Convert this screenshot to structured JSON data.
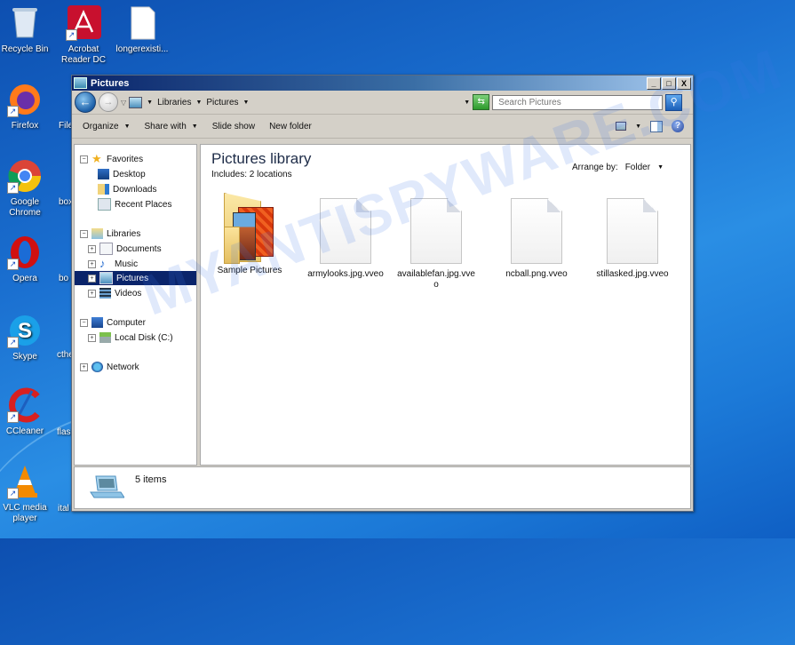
{
  "desktop": {
    "icons": [
      {
        "name": "recycle-bin",
        "label": "Recycle Bin"
      },
      {
        "name": "acrobat-reader",
        "label": "Acrobat Reader DC"
      },
      {
        "name": "longerexisting-file",
        "label": "longerexisti..."
      },
      {
        "name": "firefox",
        "label": "Firefox"
      },
      {
        "name": "google-chrome",
        "label": "Google Chrome"
      },
      {
        "name": "opera",
        "label": "Opera"
      },
      {
        "name": "skype",
        "label": "Skype"
      },
      {
        "name": "ccleaner",
        "label": "CCleaner"
      },
      {
        "name": "vlc",
        "label": "VLC media player"
      }
    ],
    "partial_labels": [
      "File",
      "box",
      "bo",
      "cthe",
      "flas",
      "ital"
    ]
  },
  "window": {
    "title": "Pictures",
    "controls": {
      "minimize": "_",
      "maximize": "□",
      "close": "X"
    },
    "address": {
      "segments": [
        "Libraries",
        "Pictures"
      ]
    },
    "search": {
      "placeholder": "Search Pictures"
    },
    "toolbar": {
      "organize": "Organize",
      "share_with": "Share with",
      "slide_show": "Slide show",
      "new_folder": "New folder",
      "help": "?"
    },
    "nav_tree": {
      "favorites": "Favorites",
      "desktop": "Desktop",
      "downloads": "Downloads",
      "recent_places": "Recent Places",
      "libraries": "Libraries",
      "documents": "Documents",
      "music": "Music",
      "pictures": "Pictures",
      "videos": "Videos",
      "computer": "Computer",
      "local_disk": "Local Disk (C:)",
      "network": "Network"
    },
    "content": {
      "title": "Pictures library",
      "subtitle": "Includes:  2 locations",
      "arrange_label": "Arrange by:",
      "arrange_value": "Folder",
      "items": [
        {
          "name": "Sample Pictures",
          "type": "folder"
        },
        {
          "name": "armylooks.jpg.vveo",
          "type": "file"
        },
        {
          "name": "availablefan.jpg.vveo",
          "type": "file"
        },
        {
          "name": "ncball.png.vveo",
          "type": "file"
        },
        {
          "name": "stillasked.jpg.vveo",
          "type": "file"
        }
      ]
    },
    "details": {
      "count": "5 items"
    }
  },
  "watermark": "MYANTISPYWARE.COM"
}
